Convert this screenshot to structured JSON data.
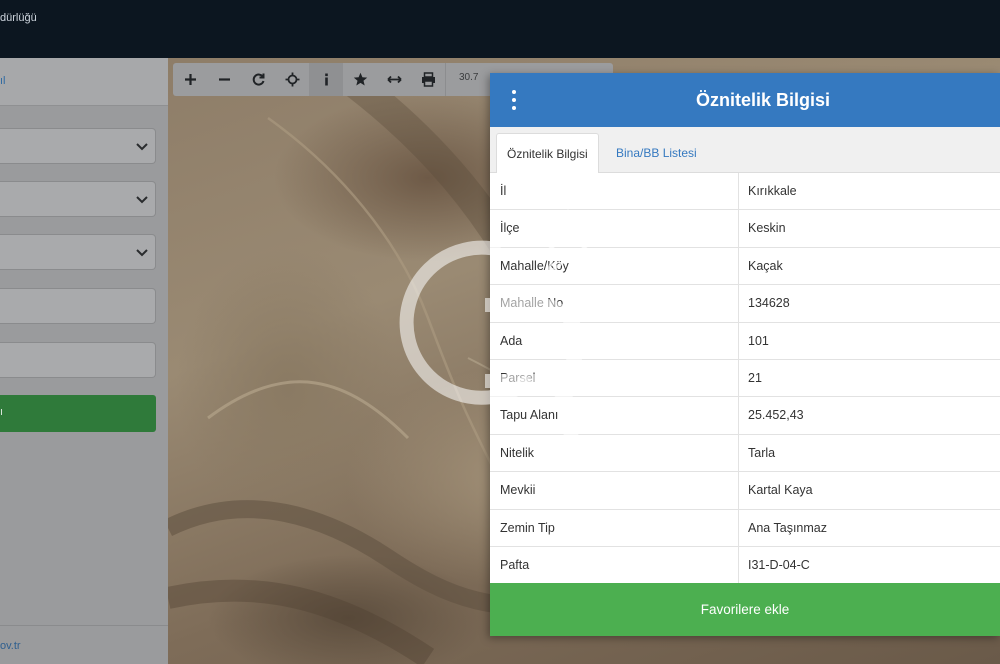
{
  "header": {
    "title": "dürlüğü"
  },
  "sidebar": {
    "top_link": "ıl",
    "submit_label": "ı",
    "footer_link": "ov.tr"
  },
  "toolbar": {
    "scale_text": "30.7"
  },
  "panel": {
    "title": "Öznitelik Bilgisi",
    "tabs": [
      {
        "label": "Öznitelik Bilgisi"
      },
      {
        "label": "Bina/BB Listesi"
      }
    ],
    "rows": [
      {
        "key": "İl",
        "value": "Kırıkkale"
      },
      {
        "key": "İlçe",
        "value": "Keskin"
      },
      {
        "key": "Mahalle/Köy",
        "value": "Kaçak"
      },
      {
        "key": "Mahalle No",
        "value": "134628"
      },
      {
        "key": "Ada",
        "value": "101"
      },
      {
        "key": "Parsel",
        "value": "21"
      },
      {
        "key": "Tapu Alanı",
        "value": "25.452,43"
      },
      {
        "key": "Nitelik",
        "value": "Tarla"
      },
      {
        "key": "Mevkii",
        "value": "Kartal Kaya"
      },
      {
        "key": "Zemin Tip",
        "value": "Ana Taşınmaz"
      },
      {
        "key": "Pafta",
        "value": "I31-D-04-C"
      }
    ],
    "favorite_button": "Favorilere ekle"
  },
  "watermark": {
    "mark": "SM"
  },
  "colors": {
    "header_bg": "#0c1620",
    "panel_header": "#3579c0",
    "favorite_green": "#4caf50",
    "link_blue": "#3579c0"
  }
}
